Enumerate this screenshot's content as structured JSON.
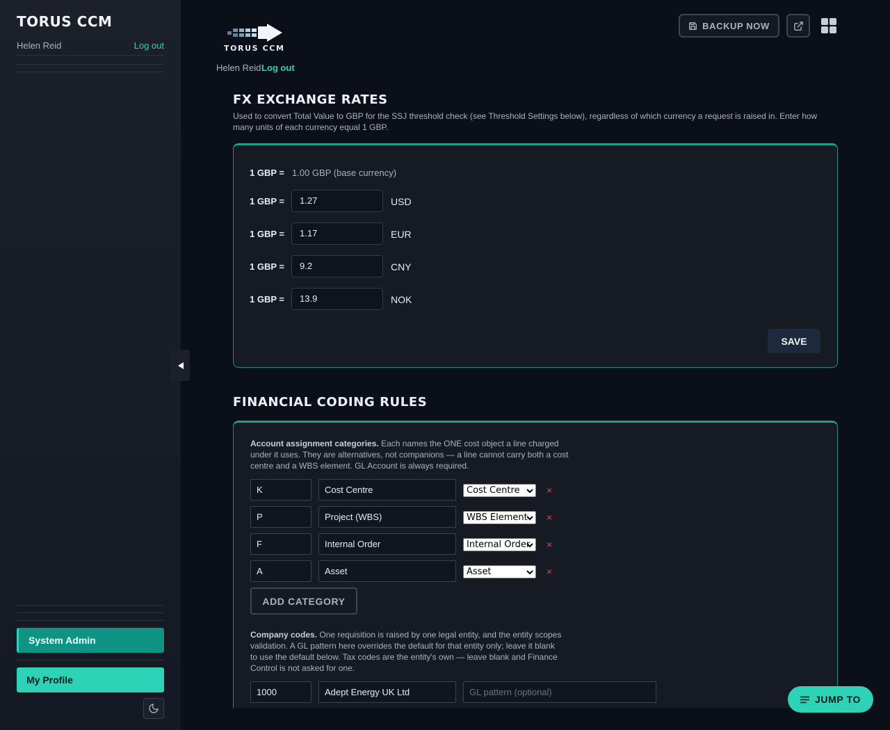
{
  "app": {
    "title": "TORUS CCM"
  },
  "user": {
    "name": "Helen Reid",
    "logout": "Log out"
  },
  "sidebar": {
    "system_admin": "System Admin",
    "my_profile": "My Profile"
  },
  "header": {
    "logo_text": "TORUS CCM",
    "backup_label": "BACKUP NOW"
  },
  "fx": {
    "title": "FX EXCHANGE RATES",
    "description": "Used to convert Total Value to GBP for the SSJ threshold check (see Threshold Settings below), regardless of which currency a request is raised in. Enter how many units of each currency equal 1 GBP.",
    "label": "1 GBP =",
    "base": "1.00 GBP (base currency)",
    "rates": [
      {
        "value": "1.27",
        "currency": "USD"
      },
      {
        "value": "1.17",
        "currency": "EUR"
      },
      {
        "value": "9.2",
        "currency": "CNY"
      },
      {
        "value": "13.9",
        "currency": "NOK"
      }
    ],
    "save_label": "SAVE"
  },
  "coding": {
    "title": "FINANCIAL CODING RULES",
    "categories_heading": "Account assignment categories.",
    "categories_text": "Each names the ONE cost object a line charged under it uses. They are alternatives, not companions — a line cannot carry both a cost centre and a WBS element. GL Account is always required.",
    "categories": [
      {
        "code": "K",
        "name": "Cost Centre",
        "type": "Cost Centre"
      },
      {
        "code": "P",
        "name": "Project (WBS)",
        "type": "WBS Element"
      },
      {
        "code": "F",
        "name": "Internal Order",
        "type": "Internal Order"
      },
      {
        "code": "A",
        "name": "Asset",
        "type": "Asset"
      }
    ],
    "delete_symbol": "×",
    "add_category": "ADD CATEGORY",
    "company_heading": "Company codes.",
    "company_text": "One requisition is raised by one legal entity, and the entity scopes validation. A GL pattern here overrides the default for that entity only; leave it blank to use the default below. Tax codes are the entity's own — leave blank and Finance Control is not asked for one.",
    "company": {
      "code": "1000",
      "name": "Adept Energy UK Ltd",
      "gl_placeholder": "GL pattern (optional)"
    }
  },
  "jump_label": "JUMP TO",
  "colors": {
    "accent": "#2ed3b7",
    "accent_dark": "#0f9385",
    "danger": "#e5484d",
    "background": "#0b0f17",
    "card": "#151a23"
  },
  "icons": [
    "save-icon",
    "external-link-icon",
    "apps-grid-icon",
    "moon-icon",
    "collapse-arrow-icon",
    "menu-lines-icon",
    "logo-arrow-icon",
    "chevron-down-icon",
    "close-icon"
  ]
}
